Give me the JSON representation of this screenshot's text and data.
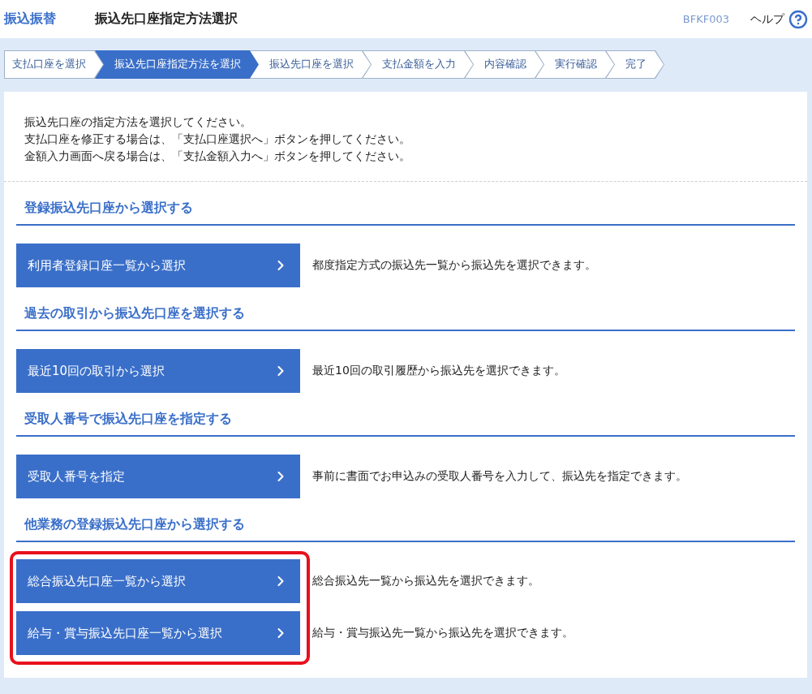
{
  "header": {
    "category": "振込振替",
    "title": "振込先口座指定方法選択",
    "screen_id": "BFKF003",
    "help": "ヘルプ"
  },
  "steps": [
    {
      "label": "支払口座を選択",
      "selected": false
    },
    {
      "label": "振込先口座指定方法を選択",
      "selected": true
    },
    {
      "label": "振込先口座を選択",
      "selected": false
    },
    {
      "label": "支払金額を入力",
      "selected": false
    },
    {
      "label": "内容確認",
      "selected": false
    },
    {
      "label": "実行確認",
      "selected": false
    },
    {
      "label": "完了",
      "selected": false
    }
  ],
  "intro": [
    "振込先口座の指定方法を選択してください。",
    "支払口座を修正する場合は、「支払口座選択へ」ボタンを押してください。",
    "金額入力画面へ戻る場合は、「支払金額入力へ」ボタンを押してください。"
  ],
  "sections": [
    {
      "heading": "登録振込先口座から選択する",
      "highlighted": false,
      "options": [
        {
          "button": "利用者登録口座一覧から選択",
          "description": "都度指定方式の振込先一覧から振込先を選択できます。"
        }
      ]
    },
    {
      "heading": "過去の取引から振込先口座を選択する",
      "highlighted": false,
      "options": [
        {
          "button": "最近10回の取引から選択",
          "description": "最近10回の取引履歴から振込先を選択できます。"
        }
      ]
    },
    {
      "heading": "受取人番号で振込先口座を指定する",
      "highlighted": false,
      "options": [
        {
          "button": "受取人番号を指定",
          "description": "事前に書面でお申込みの受取人番号を入力して、振込先を指定できます。"
        }
      ]
    },
    {
      "heading": "他業務の登録振込先口座から選択する",
      "highlighted": true,
      "options": [
        {
          "button": "総合振込先口座一覧から選択",
          "description": "総合振込先一覧から振込先を選択できます。"
        },
        {
          "button": "給与・賞与振込先口座一覧から選択",
          "description": "給与・賞与振込先一覧から振込先を選択できます。"
        }
      ]
    }
  ]
}
